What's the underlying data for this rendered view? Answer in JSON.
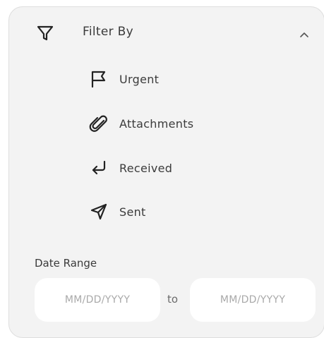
{
  "filter": {
    "title": "Filter By",
    "title_icon": "funnel-icon",
    "collapse_icon": "chevron-up-icon",
    "options": [
      {
        "label": "Urgent",
        "icon": "flag-icon"
      },
      {
        "label": "Attachments",
        "icon": "paperclip-icon"
      },
      {
        "label": "Received",
        "icon": "return-arrow-icon"
      },
      {
        "label": "Sent",
        "icon": "send-icon"
      }
    ]
  },
  "date_range": {
    "label": "Date Range",
    "from_placeholder": "MM/DD/YYYY",
    "from_value": "",
    "separator": "to",
    "to_placeholder": "MM/DD/YYYY",
    "to_value": ""
  },
  "colors": {
    "panel_bg": "#f3f3f3",
    "input_bg": "#ffffff",
    "text": "#3b3b3b",
    "placeholder": "#a9a9a9"
  }
}
